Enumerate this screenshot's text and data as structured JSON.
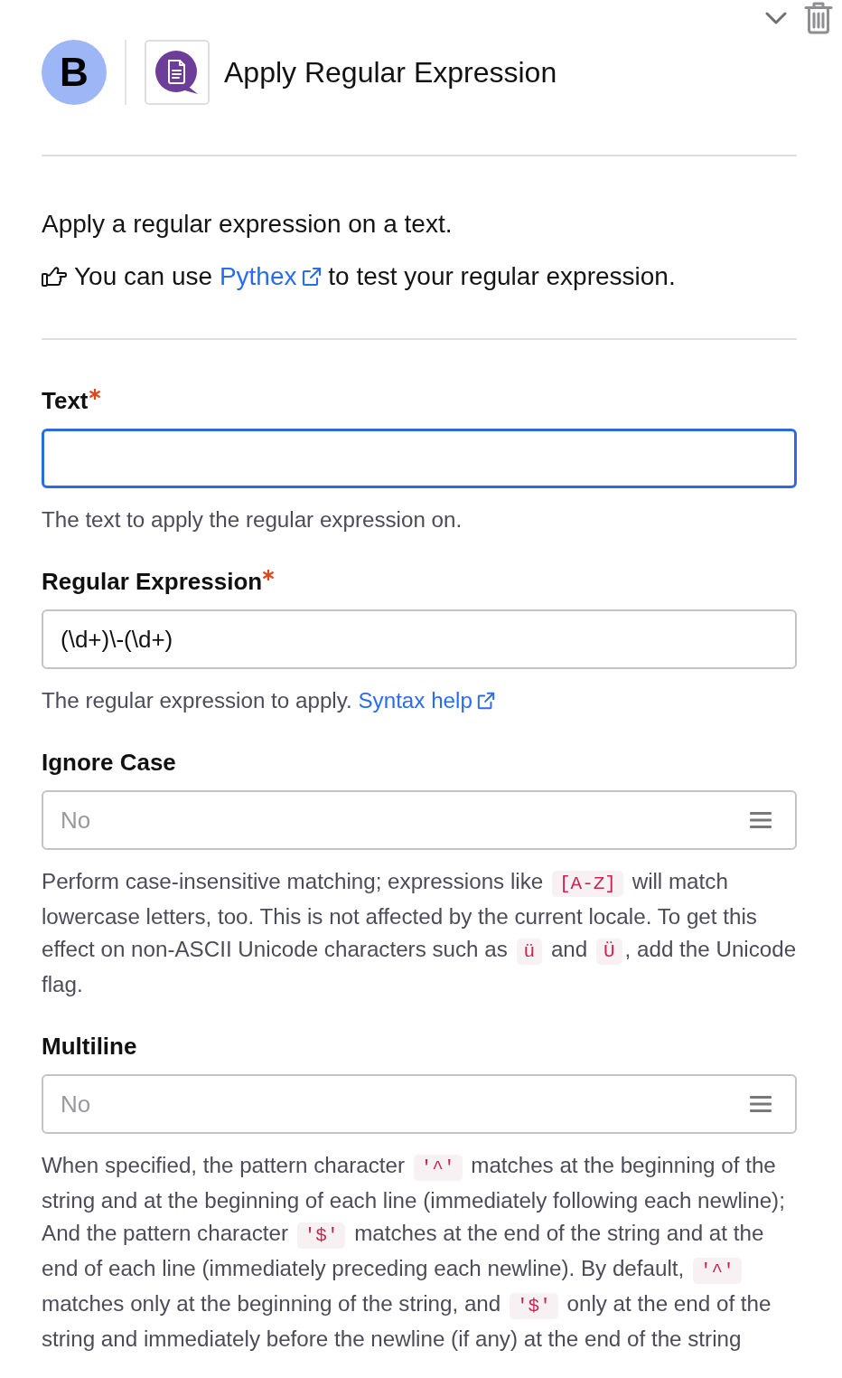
{
  "header": {
    "avatar": "B",
    "title": "Apply Regular Expression"
  },
  "intro": {
    "description": "Apply a regular expression on a text.",
    "tip": [
      {
        "kind": "text",
        "text": "You can use "
      },
      {
        "kind": "link",
        "text": "Pythex"
      },
      {
        "kind": "text",
        "text": " to test your regular expression."
      }
    ]
  },
  "fields": [
    {
      "kind": "text",
      "label": "Text",
      "required": true,
      "focused": true,
      "help": [
        {
          "kind": "text",
          "text": "The text to apply the regular expression on."
        }
      ]
    },
    {
      "kind": "text",
      "label": "Regular Expression",
      "required": true,
      "focused": false,
      "value": "(\\d+)\\-(\\d+)",
      "help": [
        {
          "kind": "text",
          "text": "The regular expression to apply. "
        },
        {
          "kind": "link",
          "text": "Syntax help"
        }
      ]
    },
    {
      "kind": "select",
      "label": "Ignore Case",
      "required": false,
      "focused": false,
      "placeholder": "No",
      "help": [
        {
          "kind": "text",
          "text": "Perform case-insensitive matching; expressions like "
        },
        {
          "kind": "code",
          "text": "[A-Z]"
        },
        {
          "kind": "text",
          "text": " will match lowercase letters, too. This is not affected by the current locale. To get this effect on non-ASCII Unicode characters such as "
        },
        {
          "kind": "code",
          "text": "ü"
        },
        {
          "kind": "text",
          "text": " and "
        },
        {
          "kind": "code",
          "text": "Ü"
        },
        {
          "kind": "text",
          "text": ", add the Unicode flag."
        }
      ]
    },
    {
      "kind": "select",
      "label": "Multiline",
      "required": false,
      "focused": false,
      "placeholder": "No",
      "help": [
        {
          "kind": "text",
          "text": "When specified, the pattern character "
        },
        {
          "kind": "code",
          "text": "'^'"
        },
        {
          "kind": "text",
          "text": " matches at the beginning of the string and at the beginning of each line (immediately following each newline); And the pattern character "
        },
        {
          "kind": "code",
          "text": "'$'"
        },
        {
          "kind": "text",
          "text": " matches at the end of the string and at the end of each line (immediately preceding each newline). By default, "
        },
        {
          "kind": "code",
          "text": "'^'"
        },
        {
          "kind": "text",
          "text": " matches only at the beginning of the string, and "
        },
        {
          "kind": "code",
          "text": "'$'"
        },
        {
          "kind": "text",
          "text": " only at the end of the string and immediately before the newline (if any) at the end of the string"
        }
      ]
    }
  ]
}
